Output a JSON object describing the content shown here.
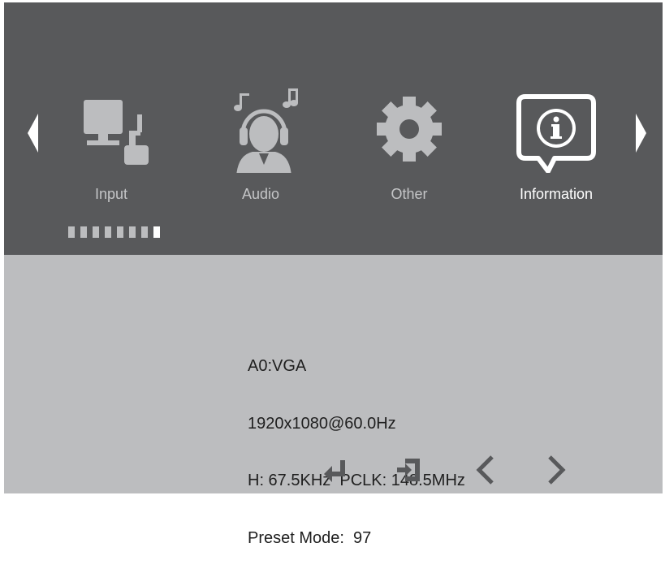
{
  "menu": {
    "items": [
      {
        "label": "Input",
        "icon": "monitor-input-icon",
        "active": false
      },
      {
        "label": "Audio",
        "icon": "headphones-person-icon",
        "active": false
      },
      {
        "label": "Other",
        "icon": "gear-icon",
        "active": false
      },
      {
        "label": "Information",
        "icon": "info-bubble-icon",
        "active": true
      }
    ],
    "page_indicator": {
      "total": 8,
      "active_index": 7
    }
  },
  "info": {
    "input": "A0:VGA",
    "resolution": "1920x1080@60.0Hz",
    "timing": "H: 67.5KHz  PCLK: 148.5MHz",
    "preset_mode": "Preset Mode:  97"
  },
  "footer": {
    "icons": [
      "enter-icon",
      "exit-icon",
      "chevron-left-icon",
      "chevron-right-icon"
    ]
  },
  "colors": {
    "top_panel": "#58595b",
    "bottom_panel": "#bcbdbf",
    "inactive_icon": "#bcbdbf",
    "active_icon": "#ffffff",
    "text_dark": "#1f1f1f"
  }
}
